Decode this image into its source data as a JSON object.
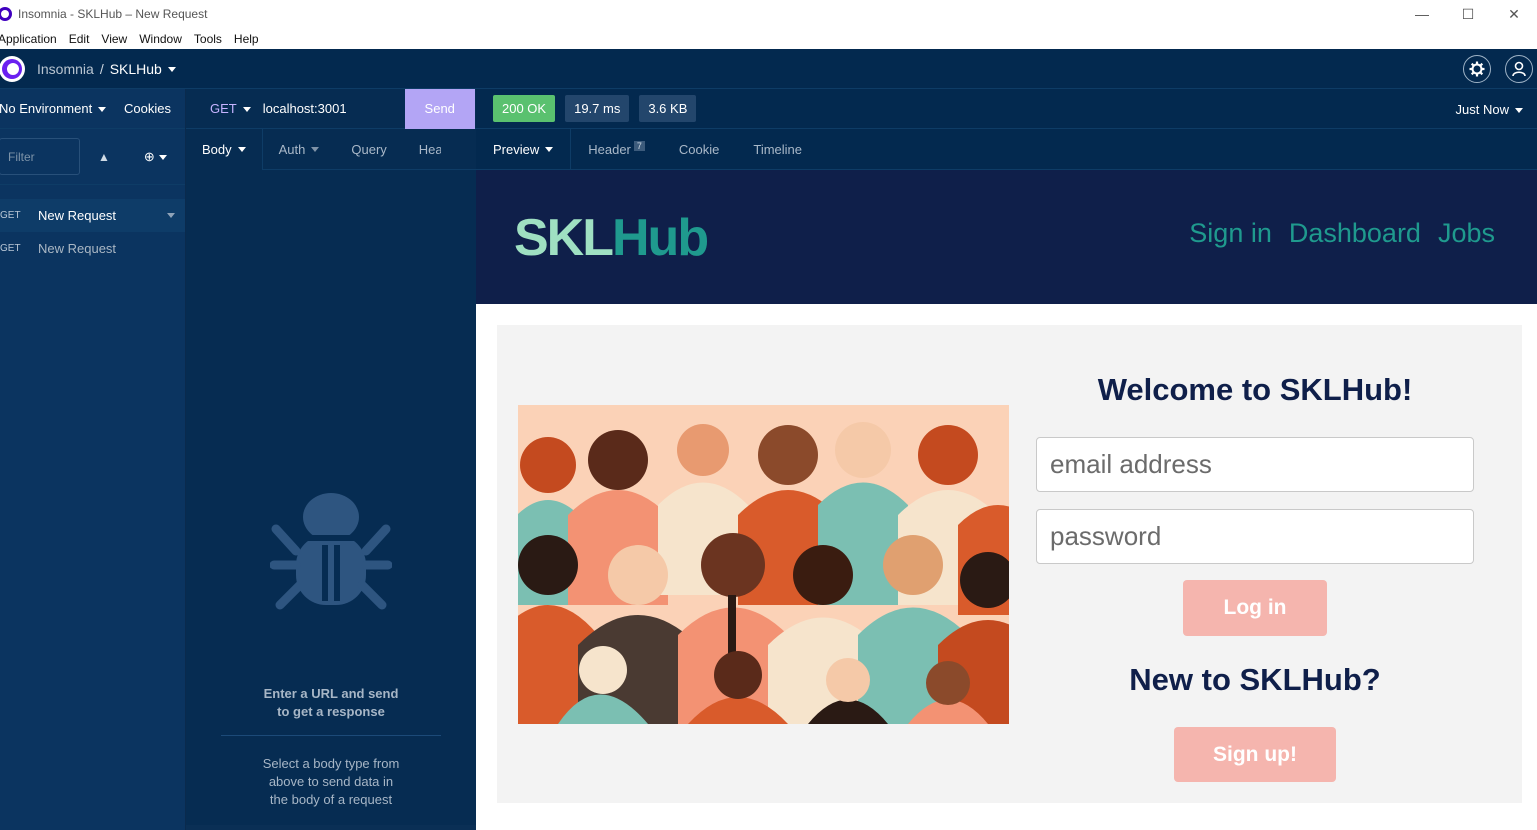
{
  "window": {
    "title": "Insomnia - SKLHub – New Request",
    "controls": [
      "—",
      "☐",
      "✕"
    ]
  },
  "menu": [
    "Application",
    "Edit",
    "View",
    "Window",
    "Tools",
    "Help"
  ],
  "appbar": {
    "app_name": "Insomnia",
    "separator": "/",
    "workspace": "SKLHub"
  },
  "sidebar": {
    "environment": "No Environment",
    "cookies": "Cookies",
    "filter_placeholder": "Filter",
    "requests": [
      {
        "method": "GET",
        "label": "New Request"
      },
      {
        "method": "GET",
        "label": "New Request"
      }
    ]
  },
  "request": {
    "method": "GET",
    "url": "localhost:3001",
    "send_label": "Send",
    "tabs": [
      "Body",
      "Auth",
      "Query",
      "Head"
    ],
    "empty_title_line1": "Enter a URL and send",
    "empty_title_line2": "to get a response",
    "empty_sub_line1": "Select a body type from",
    "empty_sub_line2": "above to send data in",
    "empty_sub_line3": "the body of a request"
  },
  "response": {
    "status": "200 OK",
    "time": "19.7 ms",
    "size": "3.6 KB",
    "history": "Just Now",
    "tabs": {
      "preview": "Preview",
      "header": "Header",
      "header_count": "7",
      "cookie": "Cookie",
      "timeline": "Timeline"
    }
  },
  "site": {
    "brand_a": "SKL",
    "brand_b": "Hub",
    "nav": [
      "Sign in",
      "Dashboard",
      "Jobs"
    ],
    "welcome": "Welcome to SKLHub!",
    "email_placeholder": "email address",
    "password_placeholder": "password",
    "login_label": "Log in",
    "new_to": "New to SKLHub?",
    "signup_label": "Sign up!"
  },
  "colors": {
    "sidebar": "#0b3460",
    "send": "#b3a5f5",
    "ok": "#5ac16f",
    "site_header": "#0f1f4a",
    "brand_teal": "#1f9a8e",
    "button_pink": "#f5b5ae"
  }
}
